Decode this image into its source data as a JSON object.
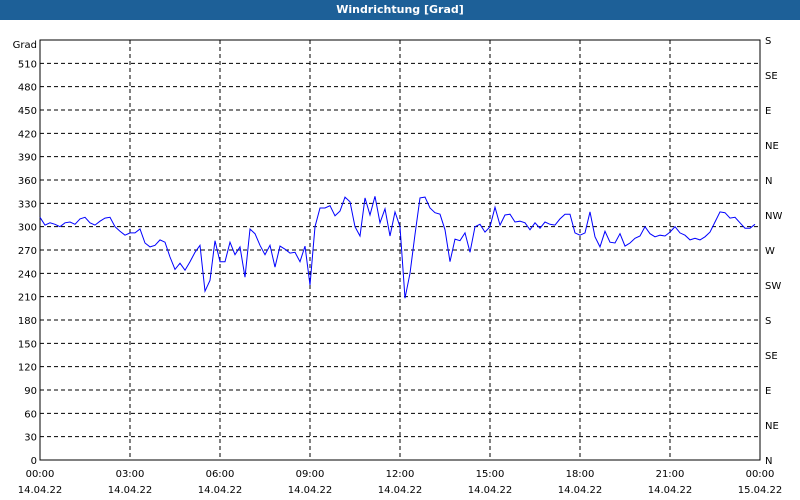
{
  "window": {
    "title": "Windrichtung [Grad]"
  },
  "chart_data": {
    "type": "line",
    "title": "Windrichtung [Grad]",
    "ylabel": "Grad",
    "xlabel": "",
    "ylim": [
      0,
      540
    ],
    "xlim_hours": [
      0,
      24
    ],
    "grid": true,
    "line_color": "#0000ff",
    "y_ticks": [
      0,
      30,
      60,
      90,
      120,
      150,
      180,
      210,
      240,
      270,
      300,
      330,
      360,
      390,
      420,
      450,
      480,
      510
    ],
    "y2_ticks": [
      {
        "value": 0,
        "label": "N"
      },
      {
        "value": 45,
        "label": "NE"
      },
      {
        "value": 90,
        "label": "E"
      },
      {
        "value": 135,
        "label": "SE"
      },
      {
        "value": 180,
        "label": "S"
      },
      {
        "value": 225,
        "label": "SW"
      },
      {
        "value": 270,
        "label": "W"
      },
      {
        "value": 315,
        "label": "NW"
      },
      {
        "value": 360,
        "label": "N"
      },
      {
        "value": 405,
        "label": "NE"
      },
      {
        "value": 450,
        "label": "E"
      },
      {
        "value": 495,
        "label": "SE"
      },
      {
        "value": 540,
        "label": "S"
      }
    ],
    "x_ticks": [
      {
        "hour": 0,
        "time": "00:00",
        "date": "14.04.22"
      },
      {
        "hour": 3,
        "time": "03:00",
        "date": "14.04.22"
      },
      {
        "hour": 6,
        "time": "06:00",
        "date": "14.04.22"
      },
      {
        "hour": 9,
        "time": "09:00",
        "date": "14.04.22"
      },
      {
        "hour": 12,
        "time": "12:00",
        "date": "14.04.22"
      },
      {
        "hour": 15,
        "time": "15:00",
        "date": "14.04.22"
      },
      {
        "hour": 18,
        "time": "18:00",
        "date": "14.04.22"
      },
      {
        "hour": 21,
        "time": "21:00",
        "date": "14.04.22"
      },
      {
        "hour": 24,
        "time": "00:00",
        "date": "15.04.22"
      }
    ],
    "series": [
      {
        "name": "Windrichtung",
        "x_start_hour": 0,
        "x_step_minutes": 10,
        "values": [
          312,
          302,
          305,
          303,
          300,
          305,
          306,
          303,
          310,
          312,
          305,
          302,
          307,
          311,
          312,
          300,
          294,
          289,
          292,
          292,
          297,
          279,
          274,
          276,
          283,
          280,
          261,
          245,
          253,
          244,
          255,
          267,
          276,
          217,
          231,
          282,
          255,
          255,
          280,
          264,
          274,
          235,
          297,
          291,
          276,
          264,
          276,
          248,
          275,
          271,
          266,
          267,
          255,
          275,
          225,
          300,
          324,
          324,
          327,
          314,
          320,
          338,
          332,
          300,
          288,
          337,
          315,
          339,
          305,
          323,
          288,
          319,
          300,
          208,
          240,
          290,
          337,
          338,
          324,
          318,
          316,
          296,
          255,
          284,
          282,
          292,
          267,
          300,
          303,
          293,
          300,
          325,
          302,
          315,
          316,
          306,
          307,
          305,
          296,
          305,
          298,
          306,
          303,
          302,
          310,
          316,
          316,
          292,
          289,
          292,
          319,
          287,
          274,
          294,
          280,
          279,
          291,
          275,
          279,
          285,
          288,
          300,
          291,
          287,
          289,
          288,
          293,
          300,
          292,
          289,
          283,
          285,
          283,
          287,
          293,
          306,
          319,
          318,
          311,
          312,
          305,
          298,
          298,
          303
        ]
      }
    ]
  }
}
